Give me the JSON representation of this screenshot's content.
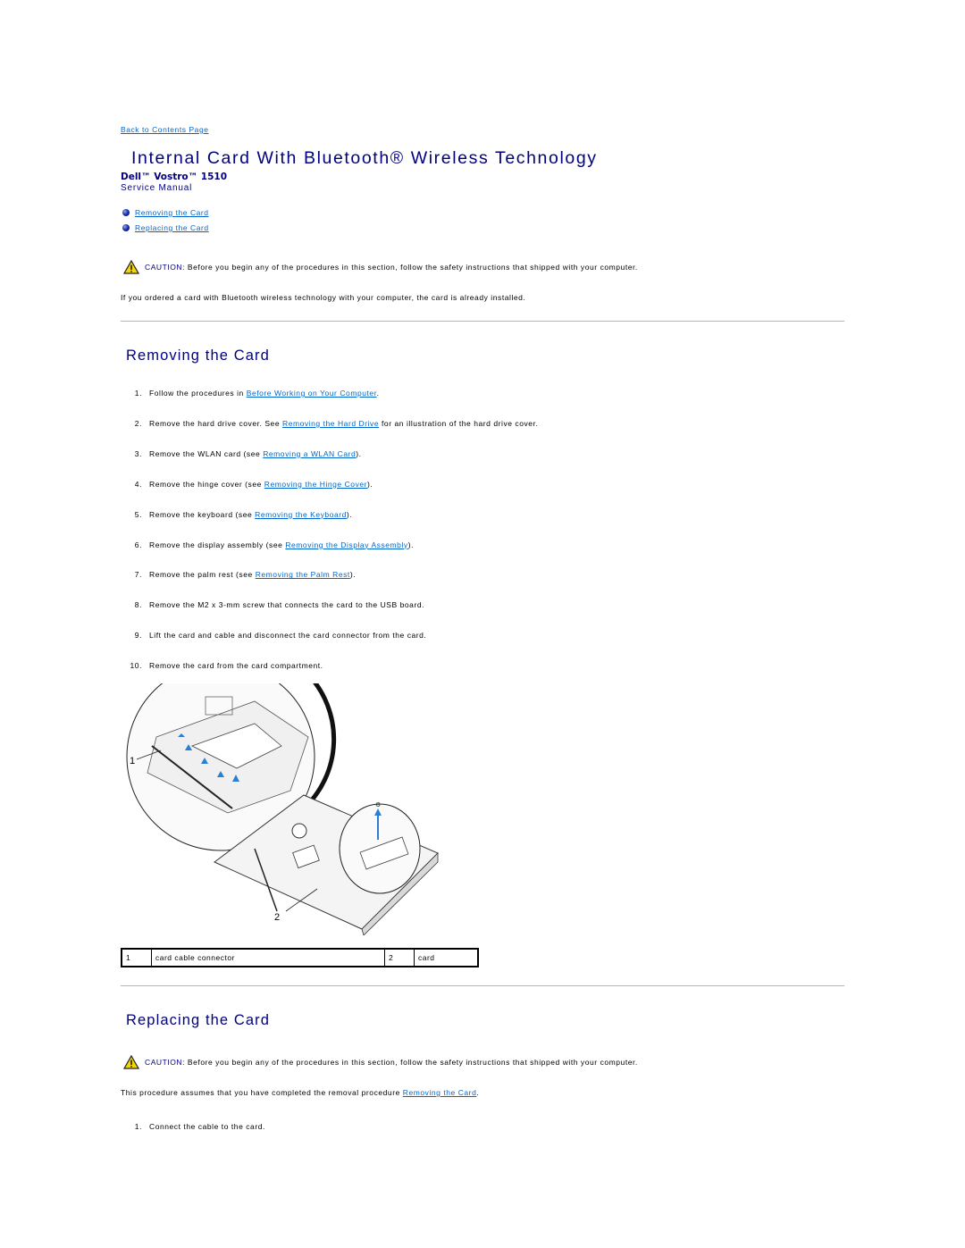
{
  "nav": {
    "back_link": "Back to Contents Page"
  },
  "header": {
    "title": "Internal Card With Bluetooth® Wireless Technology",
    "product": "Dell™ Vostro™ 1510",
    "manual": "Service Manual"
  },
  "toc": [
    {
      "label": "Removing the Card"
    },
    {
      "label": "Replacing the Card"
    }
  ],
  "caution_1": {
    "label": "CAUTION:",
    "text": " Before you begin any of the procedures in this section, follow the safety instructions that shipped with your computer."
  },
  "intro": "If you ordered a card with Bluetooth wireless technology with your computer, the card is already installed.",
  "removing": {
    "title": "Removing the Card",
    "steps": [
      {
        "num": "1.",
        "pre": "Follow the procedures in ",
        "link": "Before Working on Your Computer",
        "post": "."
      },
      {
        "num": "2.",
        "pre": "Remove the hard drive cover. See ",
        "link": "Removing the Hard Drive",
        "post": " for an illustration of the hard drive cover."
      },
      {
        "num": "3.",
        "pre": "Remove the WLAN card (see ",
        "link": "Removing a WLAN Card",
        "post": ")."
      },
      {
        "num": "4.",
        "pre": "Remove the hinge cover (see ",
        "link": "Removing the Hinge Cover",
        "post": ")."
      },
      {
        "num": "5.",
        "pre": "Remove the keyboard (see ",
        "link": "Removing the Keyboard",
        "post": ")."
      },
      {
        "num": "6.",
        "pre": "Remove the display assembly (see ",
        "link": "Removing the Display Assembly",
        "post": ")."
      },
      {
        "num": "7.",
        "pre": "Remove the palm rest (see ",
        "link": "Removing the Palm Rest",
        "post": ")."
      },
      {
        "num": "8.",
        "pre": "Remove the M2 x 3-mm screw that connects the card to the USB board.",
        "link": null,
        "post": ""
      },
      {
        "num": "9.",
        "pre": "Lift the card and cable and disconnect the card connector from the card.",
        "link": null,
        "post": ""
      },
      {
        "num": "10.",
        "pre": "Remove the card from the card compartment.",
        "link": null,
        "post": ""
      }
    ],
    "figure": {
      "callout_1": "1",
      "callout_2": "2"
    },
    "legend": [
      {
        "num": "1",
        "label": "card cable connector"
      },
      {
        "num": "2",
        "label": "card"
      }
    ]
  },
  "caution_2": {
    "label": "CAUTION:",
    "text": " Before you begin any of the procedures in this section, follow the safety instructions that shipped with your computer."
  },
  "replacing": {
    "title": "Replacing the Card",
    "intro_pre": "This procedure assumes that you have completed the removal procedure ",
    "intro_link": "Removing the Card",
    "intro_post": ".",
    "steps": [
      {
        "num": "1.",
        "text": "Connect the cable to the card."
      }
    ]
  }
}
